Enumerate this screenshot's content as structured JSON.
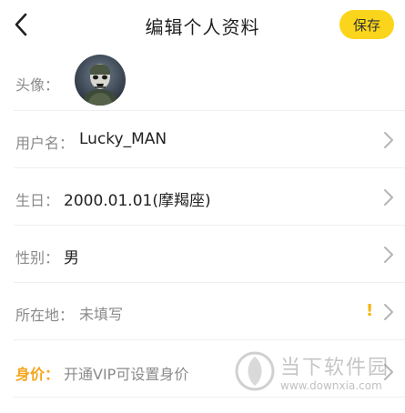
{
  "header": {
    "title": "编辑个人资料",
    "save_label": "保存",
    "back_icon": "chevron-left-icon"
  },
  "avatar_row": {
    "label": "头像："
  },
  "rows": [
    {
      "label": "用户名：",
      "value": "Lucky_MAN"
    },
    {
      "label": "生日：",
      "value": "2000.01.01(摩羯座)"
    },
    {
      "label": "性别：",
      "value": "男"
    },
    {
      "label": "所在地：",
      "value": "未填写",
      "warning": "!"
    },
    {
      "label": "身价：",
      "value": "开通VIP可设置身价"
    }
  ],
  "watermark": {
    "text": "当下软件园",
    "url": "www.downxia.com"
  },
  "colors": {
    "accent_yellow": "#fbd51b",
    "label_gray": "#8a8a8a",
    "price_orange": "#f4a51c",
    "warning_yellow": "#f5b400"
  }
}
